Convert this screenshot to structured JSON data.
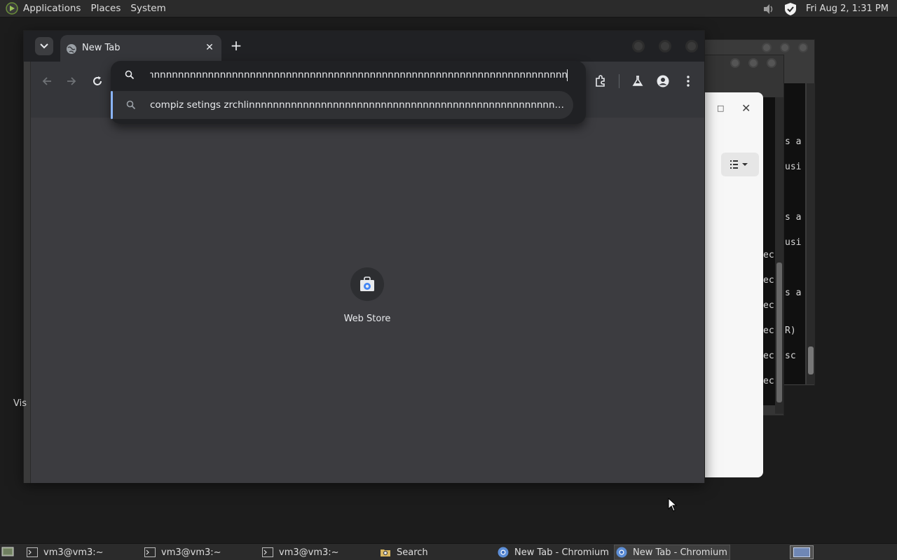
{
  "top_panel": {
    "menus": [
      "Applications",
      "Places",
      "System"
    ],
    "clock": "Fri Aug  2,  1:31 PM"
  },
  "browser": {
    "tab_title": "New Tab",
    "omnibox_text": "nnnnnnnnnnnnnnnnnnnnnnnnnnnnnnnnnnnnnnnnnnnnnnnnnnnnnnnnnnnnnnnnnnnnnnnnnnnnnn",
    "suggestion": "compiz setings zrchlinnnnnnnnnnnnnnnnnnnnnnnnnnnnnnnnnnnnnnnnnnnnnnnnnnnnnnnnnnnnnnnn...",
    "shortcut_label": "Web Store"
  },
  "terminal": {
    "lines": [
      "s a",
      "usi",
      "s a",
      "usi",
      "s a",
      "R)",
      " sc"
    ],
    "mid_lines": [
      "ec",
      "ec",
      "ec",
      "ec",
      "ec",
      "ec"
    ]
  },
  "desktop": {
    "label": "Vis"
  },
  "taskbar": {
    "items": [
      {
        "label": "vm3@vm3:~",
        "icon": "terminal-icon"
      },
      {
        "label": "vm3@vm3:~",
        "icon": "terminal-icon"
      },
      {
        "label": "vm3@vm3:~",
        "icon": "terminal-icon"
      },
      {
        "label": "Search",
        "icon": "folder-search-icon"
      },
      {
        "label": "New Tab - Chromium",
        "icon": "chromium-icon"
      },
      {
        "label": "New Tab - Chromium",
        "icon": "chromium-icon"
      }
    ]
  },
  "colors": {
    "accent": "#8ab4f8",
    "browser_frame": "#202124",
    "browser_content": "#3c3c40"
  }
}
